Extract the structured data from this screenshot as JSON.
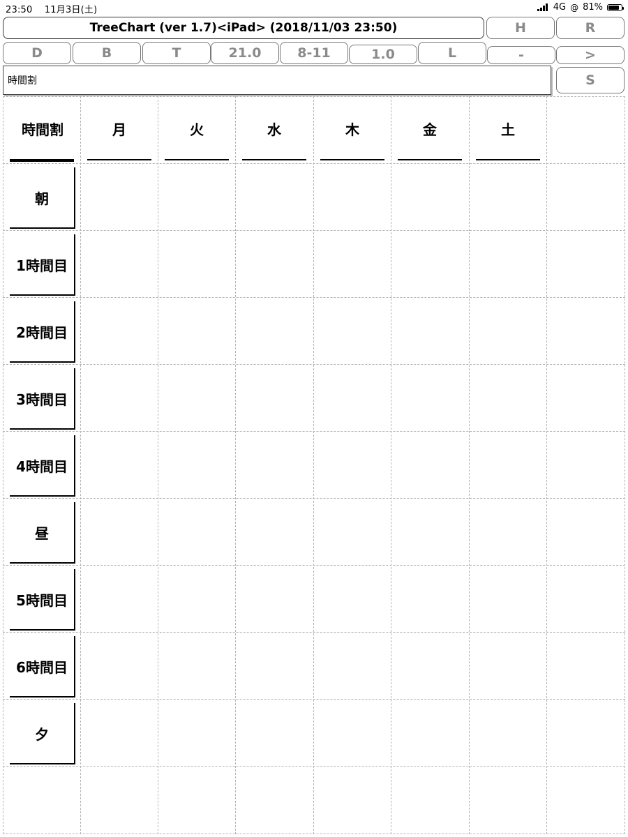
{
  "status_bar": {
    "time": "23:50",
    "date": "11月3日(土)",
    "network": "4G",
    "battery": "81%",
    "battery_level": 0.81
  },
  "toolbar": {
    "title": "TreeChart (ver 1.7)<iPad> (2018/11/03 23:50)",
    "h_label": "H",
    "r_label": "R",
    "buttons": [
      "D",
      "B",
      "T",
      "21.0",
      "8-11",
      "1.0",
      "L",
      "-",
      ">"
    ],
    "path": "時間割",
    "s_label": "S"
  },
  "timetable": {
    "corner": "時間割",
    "days": [
      "月",
      "火",
      "水",
      "木",
      "金",
      "土"
    ],
    "periods": [
      "朝",
      "1時間目",
      "2時間目",
      "3時間目",
      "4時間目",
      "昼",
      "5時間目",
      "6時間目",
      "夕"
    ]
  }
}
